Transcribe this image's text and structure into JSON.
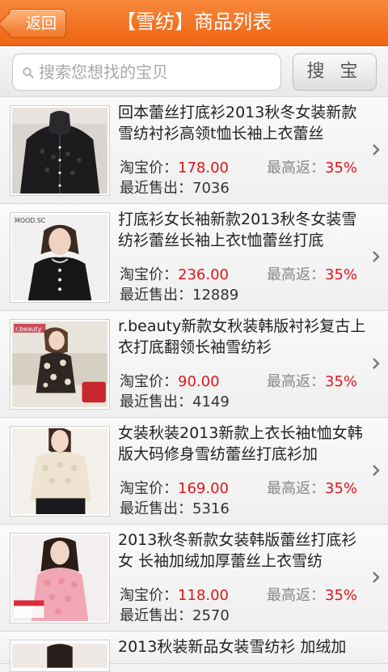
{
  "header": {
    "back_label": "返回",
    "title": "【雪纺】商品列表"
  },
  "search": {
    "placeholder": "搜索您想找的宝贝",
    "button_label": "搜 宝 贝"
  },
  "labels": {
    "price": "淘宝价：",
    "rebate": "最高返：",
    "sold": "最近售出："
  },
  "products": [
    {
      "title": "回本蕾丝打底衫2013秋冬女装新款雪纺衬衫高领t恤长袖上衣蕾丝",
      "price": "178.00",
      "rebate": "35%",
      "sold": "7036",
      "thumb_text": ""
    },
    {
      "title": "打底衫女长袖新款2013秋冬女装雪纺衫蕾丝长袖上衣t恤蕾丝打底",
      "price": "236.00",
      "rebate": "35%",
      "sold": "12889",
      "thumb_text": "MOOD.SC"
    },
    {
      "title": "r.beauty新款女秋装韩版衬衫复古上衣打底翻领长袖雪纺衫",
      "price": "90.00",
      "rebate": "35%",
      "sold": "4149",
      "thumb_text": "r.beauty"
    },
    {
      "title": "女装秋装2013新款上衣长袖t恤女韩版大码修身雪纺蕾丝打底衫加",
      "price": "169.00",
      "rebate": "35%",
      "sold": "5316",
      "thumb_text": ""
    },
    {
      "title": "2013秋冬新款女装韩版蕾丝打底衫 女 长袖加绒加厚蕾丝上衣雪纺",
      "price": "118.00",
      "rebate": "35%",
      "sold": "2570",
      "thumb_text": ""
    },
    {
      "title": "2013秋装新品女装雪纺衫 加绒加"
    }
  ]
}
